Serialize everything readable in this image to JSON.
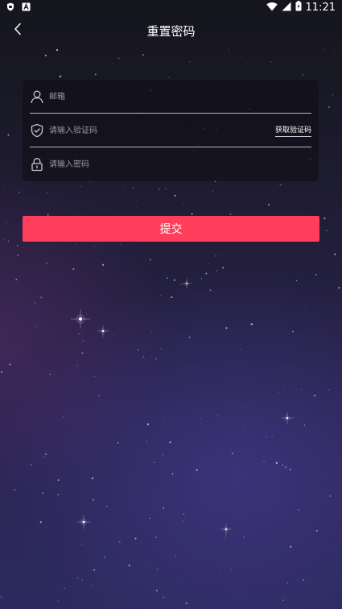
{
  "status_bar": {
    "time": "11:21",
    "left_icons": [
      "shield-icon",
      "app-a-icon"
    ],
    "right_icons": [
      "wifi-icon",
      "signal-icon",
      "battery-icon"
    ]
  },
  "header": {
    "title": "重置密码",
    "back_icon": "chevron-left-icon"
  },
  "form": {
    "email": {
      "placeholder": "邮箱",
      "value": "",
      "icon": "user-icon"
    },
    "code": {
      "placeholder": "请输入验证码",
      "value": "",
      "icon": "shield-check-icon",
      "get_code_label": "获取验证码"
    },
    "password": {
      "placeholder": "请输入密码",
      "value": "",
      "icon": "lock-icon"
    }
  },
  "submit": {
    "label": "提交"
  },
  "colors": {
    "accent": "#fe3e5a",
    "card": "#12111a",
    "placeholder": "#9a98a6"
  }
}
